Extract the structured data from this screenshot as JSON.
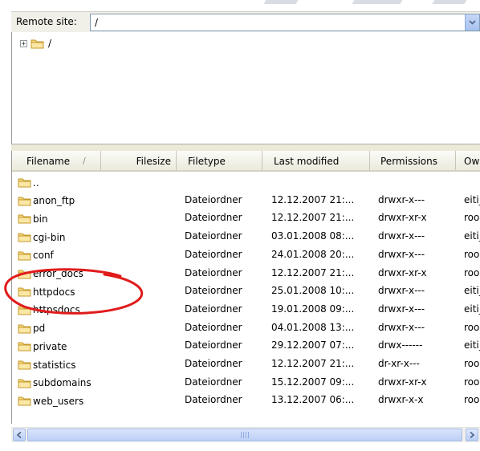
{
  "remote_site": {
    "label": "Remote site:",
    "path": "/"
  },
  "tree": {
    "expander": "+",
    "root_label": "/"
  },
  "columns": [
    "Filename",
    "Filesize",
    "Filetype",
    "Last modified",
    "Permissions",
    "Ow"
  ],
  "sort_indicator": "/",
  "rows": [
    {
      "name": "..",
      "type": "",
      "modified": "",
      "perms": "",
      "owner": ""
    },
    {
      "name": "anon_ftp",
      "type": "Dateiordner",
      "modified": "12.12.2007 21:...",
      "perms": "drwxr-x---",
      "owner": "eiti_"
    },
    {
      "name": "bin",
      "type": "Dateiordner",
      "modified": "12.12.2007 21:...",
      "perms": "drwxr-xr-x",
      "owner": "roo"
    },
    {
      "name": "cgi-bin",
      "type": "Dateiordner",
      "modified": "03.01.2008 08:...",
      "perms": "drwxr-x---",
      "owner": "eiti_"
    },
    {
      "name": "conf",
      "type": "Dateiordner",
      "modified": "24.01.2008 20:...",
      "perms": "drwxr-x---",
      "owner": "roo"
    },
    {
      "name": "error_docs",
      "type": "Dateiordner",
      "modified": "12.12.2007 21:...",
      "perms": "drwxr-xr-x",
      "owner": "roo"
    },
    {
      "name": "httpdocs",
      "type": "Dateiordner",
      "modified": "25.01.2008 10:...",
      "perms": "drwxr-x---",
      "owner": "eiti_"
    },
    {
      "name": "httpsdocs",
      "type": "Dateiordner",
      "modified": "19.01.2008 09:...",
      "perms": "drwxr-x---",
      "owner": "eiti_"
    },
    {
      "name": "pd",
      "type": "Dateiordner",
      "modified": "04.01.2008 13:...",
      "perms": "drwxr-x---",
      "owner": "roo"
    },
    {
      "name": "private",
      "type": "Dateiordner",
      "modified": "29.12.2007 07:...",
      "perms": "drwx------",
      "owner": "eiti_"
    },
    {
      "name": "statistics",
      "type": "Dateiordner",
      "modified": "12.12.2007 21:...",
      "perms": "dr-xr-x---",
      "owner": "roo"
    },
    {
      "name": "subdomains",
      "type": "Dateiordner",
      "modified": "15.12.2007 09:...",
      "perms": "drwxr-xr-x",
      "owner": "roo"
    },
    {
      "name": "web_users",
      "type": "Dateiordner",
      "modified": "13.12.2007 06:...",
      "perms": "drwxr-x-x",
      "owner": "roo"
    }
  ],
  "icons": {
    "folder": "folder-icon",
    "dropdown": "chevron-down-icon",
    "scroll_left": "arrow-left-icon",
    "scroll_right": "arrow-right-icon"
  },
  "colors": {
    "annotation": "#e11b1b",
    "folder_fill": "#f6d67a",
    "scroll_accent": "#c6d7f7"
  },
  "annotation": {
    "type": "hand-drawn ellipse",
    "target": "httpdocs"
  }
}
